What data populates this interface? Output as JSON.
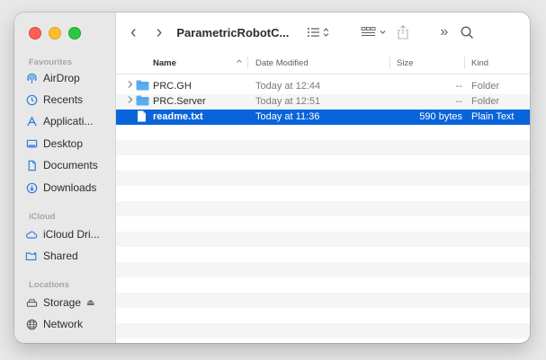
{
  "sidebar": {
    "sections": {
      "favourites": "Favourites",
      "icloud": "iCloud",
      "locations": "Locations"
    },
    "favourites": [
      {
        "label": "AirDrop",
        "icon": "airdrop-icon"
      },
      {
        "label": "Recents",
        "icon": "clock-icon"
      },
      {
        "label": "Applicati...",
        "icon": "applications-icon"
      },
      {
        "label": "Desktop",
        "icon": "desktop-icon"
      },
      {
        "label": "Documents",
        "icon": "document-icon"
      },
      {
        "label": "Downloads",
        "icon": "download-icon"
      }
    ],
    "icloud": [
      {
        "label": "iCloud Dri...",
        "icon": "cloud-icon"
      },
      {
        "label": "Shared",
        "icon": "shared-folder-icon"
      }
    ],
    "locations": [
      {
        "label": "Storage",
        "icon": "drive-icon",
        "eject": "⏏"
      },
      {
        "label": "Network",
        "icon": "globe-icon"
      }
    ]
  },
  "toolbar": {
    "back": "‹",
    "forward": "›",
    "title": "ParametricRobotC...",
    "overflow": "»"
  },
  "list": {
    "columns": {
      "name": "Name",
      "date": "Date Modified",
      "size": "Size",
      "kind": "Kind"
    },
    "rows": [
      {
        "name": "PRC.GH",
        "date": "Today at 12:44",
        "size": "--",
        "kind": "Folder",
        "type": "folder"
      },
      {
        "name": "PRC.Server",
        "date": "Today at 12:51",
        "size": "--",
        "kind": "Folder",
        "type": "folder"
      },
      {
        "name": "readme.txt",
        "date": "Today at 11:36",
        "size": "590 bytes",
        "kind": "Plain Text",
        "type": "file",
        "selected": true
      }
    ]
  },
  "colors": {
    "selection": "#0a64d9",
    "folder": "#5aaef0",
    "sidebar_icon": "#2f7de1"
  }
}
